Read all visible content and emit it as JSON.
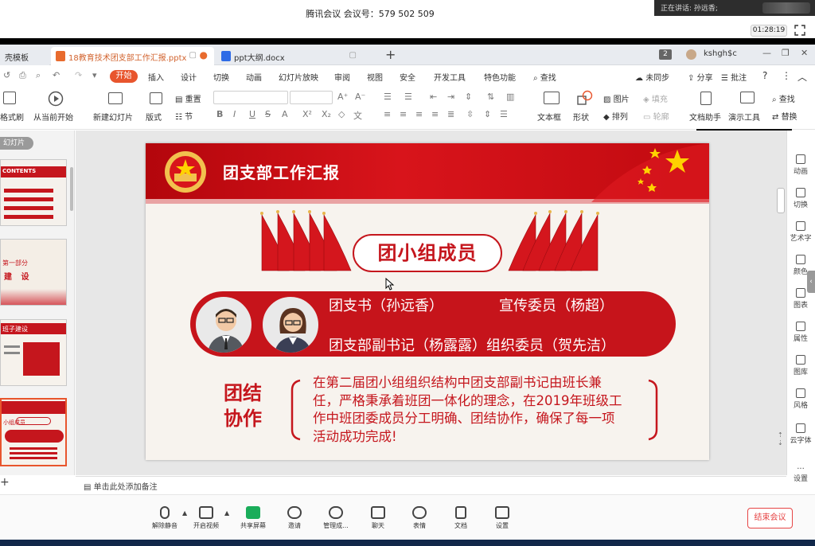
{
  "meeting": {
    "title": "腾讯会议 会议号：579 502 509",
    "speaking": "正在讲话: 孙远香;",
    "timer": "01:28:19"
  },
  "tabs": [
    {
      "label": "壳模板"
    },
    {
      "label": "18教育技术团支部工作汇报.pptx"
    },
    {
      "label": "ppt大纲.docx"
    }
  ],
  "tabbar": {
    "badge": "2",
    "user": "kshgh$c"
  },
  "menu": [
    "开始",
    "插入",
    "设计",
    "切换",
    "动画",
    "幻灯片放映",
    "审阅",
    "视图",
    "安全",
    "开发工具",
    "特色功能",
    "查找"
  ],
  "menu_right": [
    "未同步",
    "分享",
    "批注"
  ],
  "ribbon": {
    "format_painter": "格式刷",
    "play_from_current": "从当前开始",
    "new_slide": "新建幻灯片",
    "layout": "版式",
    "reset": "重置",
    "section": "节",
    "textbox": "文本框",
    "shape": "形状",
    "picture": "图片",
    "fill": "填充",
    "arrange": "排列",
    "outline": "轮廓",
    "doc_assistant": "文档助手",
    "presentation_tools": "演示工具",
    "find": "查找",
    "replace": "替换"
  },
  "left_panel": {
    "label": "幻灯片",
    "thumbs": [
      {
        "title": "CONTENTS"
      },
      {
        "title": "第一部分",
        "subtitle": "建 设"
      },
      {
        "title": "班子建设"
      },
      {
        "title": "小组成员"
      }
    ]
  },
  "slide": {
    "title": "团支部工作汇报",
    "section": "团小组成员",
    "members": {
      "line1_left": "团支书（孙远香）",
      "line1_right": "宣传委员（杨超）",
      "line2": "团支部副书记（杨露露）组织委员（贺先洁）"
    },
    "teamwork_title": "团结协作",
    "teamwork_text": "在第二届团小组组织结构中团支部副书记由班长兼任，严格秉承着班团一体化的理念，在2019年班级工作中班团委成员分工明确、团结协作，确保了每一项活动成功完成!"
  },
  "right_panel": [
    "动画",
    "切换",
    "艺术字",
    "颜色",
    "图表",
    "属性",
    "图库",
    "风格",
    "云字体",
    "设置"
  ],
  "notes_placeholder": "单击此处添加备注",
  "bottom_bar": [
    "解除静音",
    "开启视频",
    "共享屏幕",
    "邀请",
    "管理成...",
    "聊天",
    "表情",
    "文档",
    "设置"
  ],
  "end_meeting": "结束会议",
  "colors": {
    "accent": "#e8552d",
    "slide_red": "#c5161d",
    "end_red": "#e64545"
  }
}
